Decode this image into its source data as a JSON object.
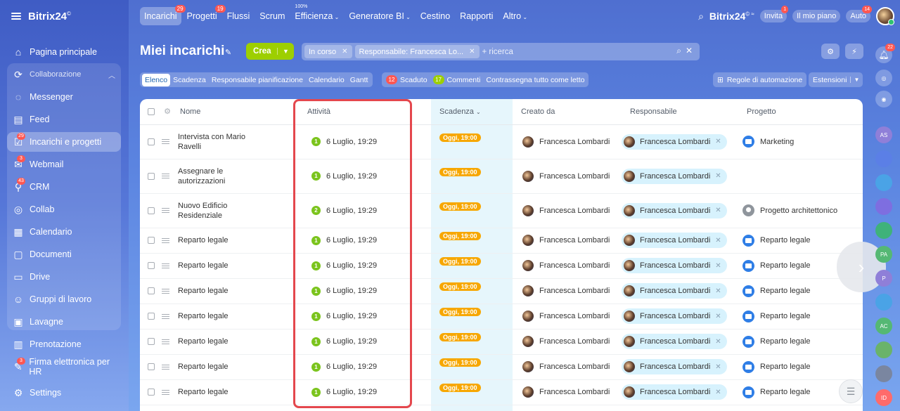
{
  "app": {
    "logo": "Bitrix24",
    "logo_mark": "©"
  },
  "sidebar": {
    "items": [
      {
        "label": "Pagina principale",
        "icon": "home-icon",
        "badge": ""
      },
      {
        "label": "Collaborazione",
        "icon": "collaboration-icon",
        "badge": ""
      },
      {
        "label": "Messenger",
        "icon": "chat-icon",
        "badge": ""
      },
      {
        "label": "Feed",
        "icon": "feed-icon",
        "badge": ""
      },
      {
        "label": "Incarichi e progetti",
        "icon": "tasks-icon",
        "badge": "29"
      },
      {
        "label": "Webmail",
        "icon": "mail-icon",
        "badge": "3"
      },
      {
        "label": "CRM",
        "icon": "crm-icon",
        "badge": "43"
      },
      {
        "label": "Collab",
        "icon": "collab-icon",
        "badge": ""
      },
      {
        "label": "Calendario",
        "icon": "calendar-icon",
        "badge": ""
      },
      {
        "label": "Documenti",
        "icon": "document-icon",
        "badge": ""
      },
      {
        "label": "Drive",
        "icon": "drive-icon",
        "badge": ""
      },
      {
        "label": "Gruppi di lavoro",
        "icon": "workgroups-icon",
        "badge": ""
      },
      {
        "label": "Lavagne",
        "icon": "board-icon",
        "badge": ""
      },
      {
        "label": "Prenotazione",
        "icon": "booking-icon",
        "badge": ""
      },
      {
        "label": "Firma elettronica per HR",
        "icon": "signature-icon",
        "badge": "3"
      }
    ],
    "settings": "Settings"
  },
  "topbar": {
    "tabs": [
      {
        "label": "Incarichi",
        "badge": "29",
        "sup": ""
      },
      {
        "label": "Progetti",
        "badge": "19",
        "sup": ""
      },
      {
        "label": "Flussi",
        "badge": "",
        "sup": ""
      },
      {
        "label": "Scrum",
        "badge": "",
        "sup": ""
      },
      {
        "label": "Efficienza",
        "badge": "",
        "sup": "100%"
      },
      {
        "label": "Generatore BI",
        "badge": "",
        "sup": ""
      },
      {
        "label": "Cestino",
        "badge": "",
        "sup": ""
      },
      {
        "label": "Rapporti",
        "badge": "",
        "sup": ""
      },
      {
        "label": "Altro",
        "badge": "",
        "sup": ""
      }
    ],
    "brand": "Bitrix24",
    "invite": "Invita",
    "invite_badge": "1",
    "plan": "Il mio piano",
    "auto": "Auto",
    "auto_badge": "14"
  },
  "page": {
    "title": "Miei incarichi",
    "create": "Crea",
    "filter_chips": [
      "In corso",
      "Responsabile: Francesca Lo..."
    ],
    "search_placeholder": "+ ricerca"
  },
  "views": {
    "items": [
      "Elenco",
      "Scadenza",
      "Responsabile pianificazione",
      "Calendario",
      "Gantt"
    ],
    "active": "Elenco"
  },
  "counters": {
    "overdue_count": "12",
    "overdue_label": "Scaduto",
    "comments_count": "17",
    "comments_label": "Commenti",
    "mark_read": "Contrassegna tutto come letto"
  },
  "toolbar": {
    "automation": "Regole di automazione",
    "extensions": "Estensioni"
  },
  "table": {
    "columns": {
      "name": "Nome",
      "activity": "Attività",
      "deadline": "Scadenza",
      "created_by": "Creato da",
      "responsible": "Responsabile",
      "project": "Progetto"
    },
    "rows": [
      {
        "name": "Intervista con Mario Ravelli",
        "activity_count": "1",
        "activity": "6 Luglio, 19:29",
        "deadline": "Oggi, 19:00",
        "created_by": "Francesca Lombardi",
        "responsible": "Francesca Lombardi",
        "project": "Marketing",
        "project_icon": "folder"
      },
      {
        "name": "Assegnare le autorizzazioni",
        "activity_count": "1",
        "activity": "6 Luglio, 19:29",
        "deadline": "Oggi, 19:00",
        "created_by": "Francesca Lombardi",
        "responsible": "Francesca Lombardi",
        "project": "",
        "project_icon": ""
      },
      {
        "name": "Nuovo Edificio Residenziale",
        "activity_count": "2",
        "activity": "6 Luglio, 19:29",
        "deadline": "Oggi, 19:00",
        "created_by": "Francesca Lombardi",
        "responsible": "Francesca Lombardi",
        "project": "Progetto architettonico",
        "project_icon": "group"
      },
      {
        "name": "Reparto legale",
        "activity_count": "1",
        "activity": "6 Luglio, 19:29",
        "deadline": "Oggi, 19:00",
        "created_by": "Francesca Lombardi",
        "responsible": "Francesca Lombardi",
        "project": "Reparto legale",
        "project_icon": "folder"
      },
      {
        "name": "Reparto legale",
        "activity_count": "1",
        "activity": "6 Luglio, 19:29",
        "deadline": "Oggi, 19:00",
        "created_by": "Francesca Lombardi",
        "responsible": "Francesca Lombardi",
        "project": "Reparto legale",
        "project_icon": "folder"
      },
      {
        "name": "Reparto legale",
        "activity_count": "1",
        "activity": "6 Luglio, 19:29",
        "deadline": "Oggi, 19:00",
        "created_by": "Francesca Lombardi",
        "responsible": "Francesca Lombardi",
        "project": "Reparto legale",
        "project_icon": "folder"
      },
      {
        "name": "Reparto legale",
        "activity_count": "1",
        "activity": "6 Luglio, 19:29",
        "deadline": "Oggi, 19:00",
        "created_by": "Francesca Lombardi",
        "responsible": "Francesca Lombardi",
        "project": "Reparto legale",
        "project_icon": "folder"
      },
      {
        "name": "Reparto legale",
        "activity_count": "1",
        "activity": "6 Luglio, 19:29",
        "deadline": "Oggi, 19:00",
        "created_by": "Francesca Lombardi",
        "responsible": "Francesca Lombardi",
        "project": "Reparto legale",
        "project_icon": "folder"
      },
      {
        "name": "Reparto legale",
        "activity_count": "1",
        "activity": "6 Luglio, 19:29",
        "deadline": "Oggi, 19:00",
        "created_by": "Francesca Lombardi",
        "responsible": "Francesca Lombardi",
        "project": "Reparto legale",
        "project_icon": "folder"
      },
      {
        "name": "Reparto legale",
        "activity_count": "1",
        "activity": "6 Luglio, 19:29",
        "deadline": "Oggi, 19:00",
        "created_by": "Francesca Lombardi",
        "responsible": "Francesca Lombardi",
        "project": "Reparto legale",
        "project_icon": "folder"
      }
    ]
  },
  "rail": {
    "bell_badge": "22",
    "avatars": [
      "AS",
      "",
      "",
      "",
      "",
      "PA",
      "P",
      "",
      "AC",
      "",
      "",
      "ID"
    ]
  },
  "colors": {
    "accent": "#2066b0",
    "create": "#9dcf00",
    "deadline": "#f7a700",
    "badge": "#ff5752",
    "highlight": "#e4474d"
  }
}
